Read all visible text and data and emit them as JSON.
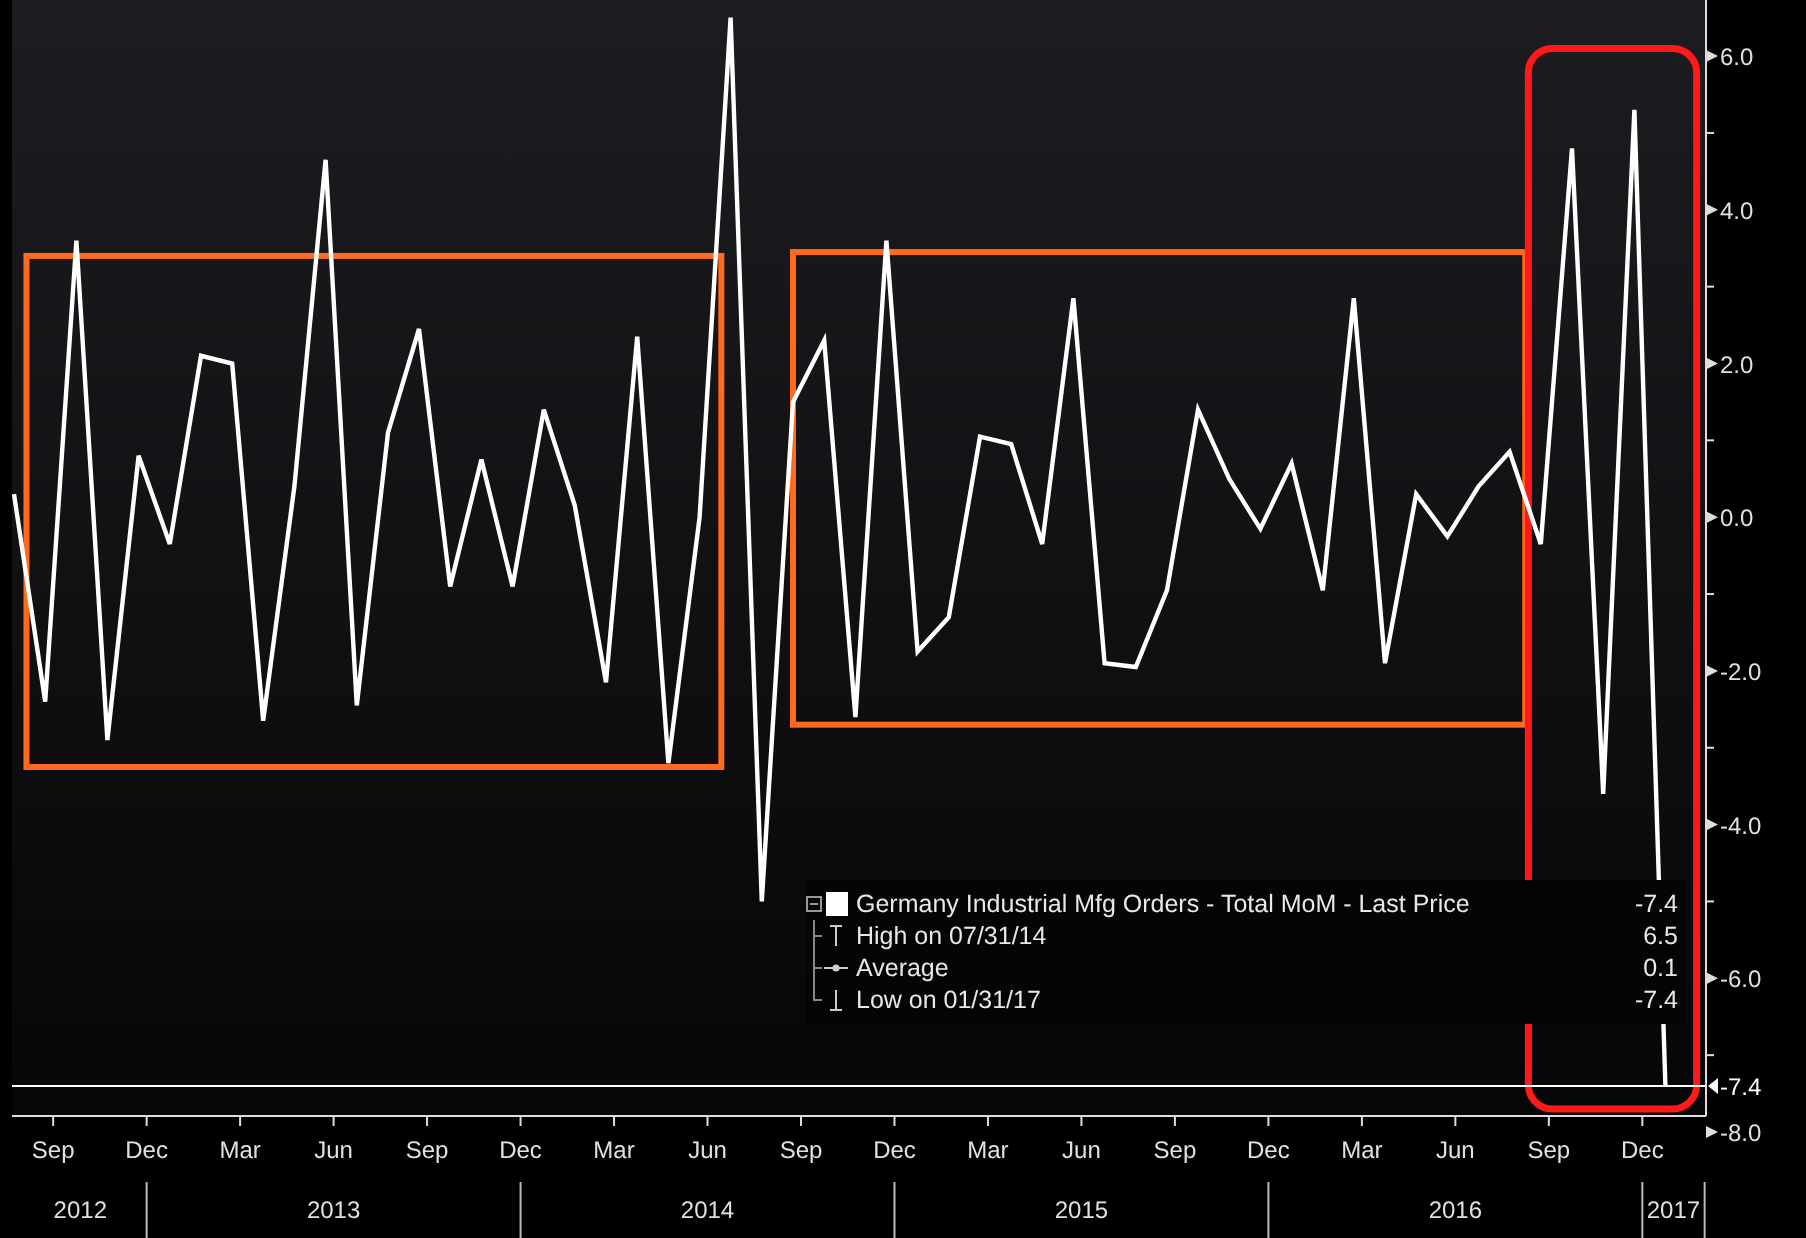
{
  "chart_data": {
    "type": "line",
    "categories": [
      null,
      "Sep",
      null,
      null,
      "Dec",
      null,
      null,
      "Mar",
      null,
      null,
      "Jun",
      null,
      null,
      "Sep",
      null,
      null,
      "Dec",
      null,
      null,
      "Mar",
      null,
      null,
      "Jun",
      null,
      null,
      "Sep",
      null,
      null,
      "Dec",
      null,
      null,
      "Mar",
      null,
      null,
      "Jun",
      null,
      null,
      "Sep",
      null,
      null,
      "Dec",
      null,
      null,
      "Mar",
      null,
      null,
      "Jun",
      null,
      null,
      "Sep",
      null,
      null,
      "Dec",
      null
    ],
    "series": [
      {
        "name": "Germany Industrial Mfg Orders - Total MoM - Last Price",
        "color": "#ffffff",
        "values": [
          0.3,
          -2.4,
          3.6,
          -2.9,
          0.8,
          -0.35,
          2.1,
          2.0,
          -2.65,
          0.4,
          4.65,
          -2.45,
          1.1,
          2.45,
          -0.9,
          0.75,
          -0.9,
          1.4,
          0.15,
          -2.15,
          2.35,
          -3.2,
          0.0,
          6.5,
          -5.0,
          1.5,
          2.3,
          -2.6,
          3.6,
          -1.75,
          -1.3,
          1.05,
          0.95,
          -0.35,
          2.85,
          -1.9,
          -1.95,
          -0.95,
          1.4,
          0.5,
          -0.15,
          0.7,
          -0.95,
          2.85,
          -1.9,
          0.3,
          -0.25,
          0.4,
          0.85,
          -0.35,
          4.8,
          -3.6,
          5.3,
          -7.4
        ]
      }
    ],
    "ylim": [
      -8.0,
      6.73
    ],
    "yticks": [
      {
        "value": 6,
        "label": "6.0"
      },
      {
        "value": 4,
        "label": "4.0"
      },
      {
        "value": 2,
        "label": "2.0"
      },
      {
        "value": 0,
        "label": "0.0"
      },
      {
        "value": -2,
        "label": "-2.0"
      },
      {
        "value": -4,
        "label": "-4.0"
      },
      {
        "value": -6,
        "label": "-6.0"
      },
      {
        "value": -8,
        "label": "-8.0"
      }
    ],
    "ref_lines": [
      {
        "axis": "y",
        "value": -7.4,
        "label": "-7.4",
        "color": "#ffffff"
      }
    ]
  },
  "highlights": [
    {
      "color": "#ff6a1f"
    },
    {
      "color": "#ff6a1f"
    },
    {
      "color": "#ff1a1a"
    }
  ],
  "year_axis": [
    {
      "label": "2012"
    },
    {
      "label": "2013"
    },
    {
      "label": "2014"
    },
    {
      "label": "2015"
    },
    {
      "label": "2016"
    },
    {
      "label": "2017"
    }
  ],
  "legend": [
    {
      "kind": "series",
      "value": "-7.4"
    },
    {
      "kind": "high",
      "label": "High on 07/31/14",
      "value": "6.5"
    },
    {
      "kind": "average",
      "label": "Average",
      "value": "0.1"
    },
    {
      "kind": "low",
      "label": "Low on 01/31/17",
      "value": "-7.4"
    }
  ]
}
